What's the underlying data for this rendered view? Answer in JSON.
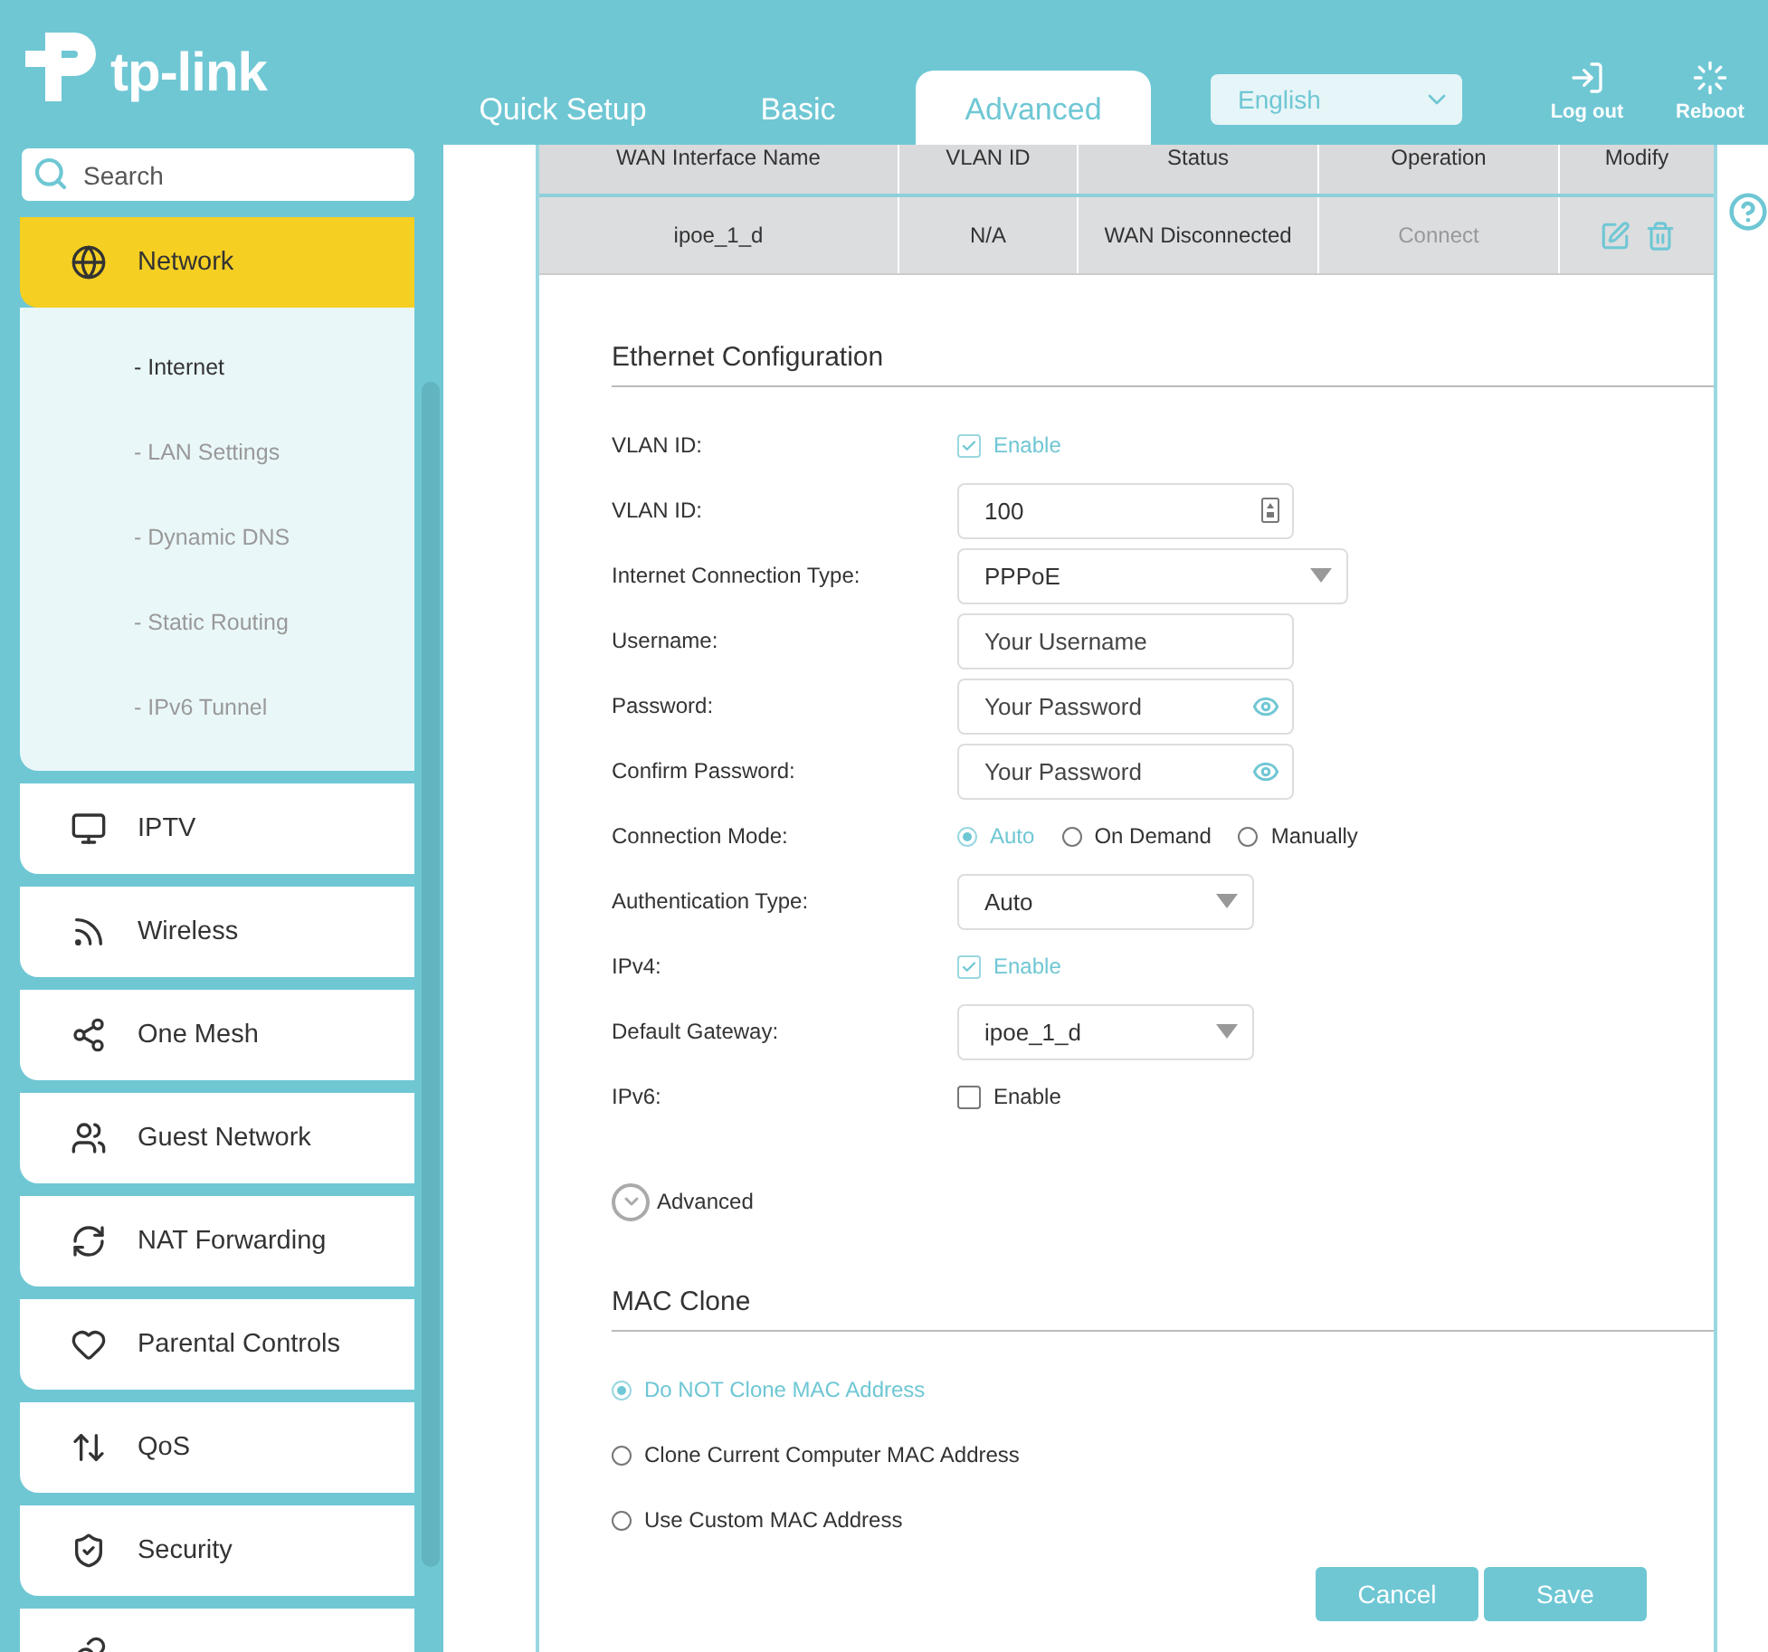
{
  "header": {
    "logo": "tp-link",
    "tabs": [
      {
        "label": "Quick Setup",
        "selected": false
      },
      {
        "label": "Basic",
        "selected": false
      },
      {
        "label": "Advanced",
        "selected": true
      }
    ],
    "language": "English",
    "actions": [
      {
        "kind": "logout",
        "label": "Log out"
      },
      {
        "kind": "reboot",
        "label": "Reboot"
      }
    ]
  },
  "sidebar": {
    "search": {
      "placeholder": "Search"
    },
    "items": [
      {
        "label": "Network",
        "selected": true,
        "expanded": true,
        "children": [
          {
            "label": "- Internet",
            "selected": true
          },
          {
            "label": "- LAN Settings",
            "selected": false
          },
          {
            "label": "- Dynamic DNS",
            "selected": false
          },
          {
            "label": "- Static Routing",
            "selected": false
          },
          {
            "label": "- IPv6 Tunnel",
            "selected": false
          }
        ]
      },
      {
        "label": "IPTV",
        "selected": false
      },
      {
        "label": "Wireless",
        "selected": false
      },
      {
        "label": "One Mesh",
        "selected": false
      },
      {
        "label": "Guest Network",
        "selected": false
      },
      {
        "label": "NAT Forwarding",
        "selected": false
      },
      {
        "label": "Parental Controls",
        "selected": false
      },
      {
        "label": "QoS",
        "selected": false
      },
      {
        "label": "Security",
        "selected": false
      }
    ]
  },
  "table": {
    "columns": [
      "WAN Interface Name",
      "VLAN ID",
      "Status",
      "Operation",
      "Modify"
    ],
    "rows": [
      {
        "name": "ipoe_1_d",
        "vlan_id": "N/A",
        "status": "WAN Disconnected",
        "operation": "Connect"
      }
    ]
  },
  "ethernet": {
    "title": "Ethernet Configuration",
    "fields": [
      {
        "kind": "checkbox",
        "label": "VLAN ID:",
        "text": "Enable",
        "checked": true
      },
      {
        "kind": "number",
        "label": "VLAN ID:",
        "value": "100"
      },
      {
        "kind": "select",
        "wide": true,
        "label": "Internet Connection Type:",
        "value": "PPPoE"
      },
      {
        "kind": "text",
        "label": "Username:",
        "placeholder": "Your Username"
      },
      {
        "kind": "password",
        "label": "Password:",
        "placeholder": "Your Password"
      },
      {
        "kind": "password",
        "label": "Confirm Password:",
        "placeholder": "Your Password"
      },
      {
        "kind": "radio",
        "label": "Connection Mode:",
        "options": [
          {
            "label": "Auto",
            "selected": true
          },
          {
            "label": "On Demand",
            "selected": false
          },
          {
            "label": "Manually",
            "selected": false
          }
        ]
      },
      {
        "kind": "select",
        "wide": false,
        "label": "Authentication Type:",
        "value": "Auto"
      },
      {
        "kind": "checkbox",
        "label": "IPv4:",
        "text": "Enable",
        "checked": true
      },
      {
        "kind": "select",
        "wide": false,
        "label": "Default Gateway:",
        "value": "ipoe_1_d"
      },
      {
        "kind": "checkbox",
        "label": "IPv6:",
        "text": "Enable",
        "checked": false
      }
    ],
    "advanced": {
      "label": "Advanced",
      "expanded": false
    }
  },
  "mac_clone": {
    "title": "MAC Clone",
    "options": [
      {
        "label": "Do NOT Clone MAC Address",
        "selected": true
      },
      {
        "label": "Clone Current Computer MAC Address",
        "selected": false
      },
      {
        "label": "Use Custom MAC Address",
        "selected": false
      }
    ]
  },
  "buttons": [
    "Cancel",
    "Save"
  ]
}
